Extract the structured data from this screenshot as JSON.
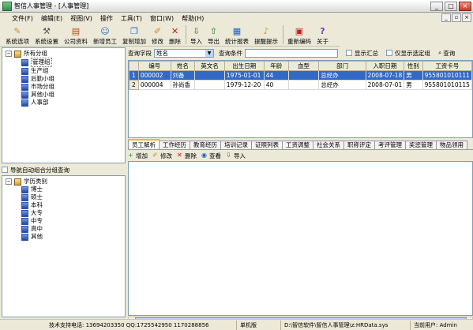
{
  "window": {
    "title": "智信人事管理 - [人事管理]"
  },
  "menu": [
    "文件(F)",
    "编辑(E)",
    "视图(V)",
    "操作",
    "工具(T)",
    "窗口(W)",
    "帮助(H)"
  ],
  "toolbar": [
    {
      "label": "系统选项",
      "icon": "pencil-icon"
    },
    {
      "label": "系统设置",
      "icon": "tools-icon"
    },
    {
      "label": "公司资料",
      "icon": "books-icon"
    },
    {
      "label": "新增员工",
      "icon": "person-add-icon"
    },
    {
      "label": "复制增加",
      "icon": "copy-icon"
    },
    {
      "label": "修改",
      "icon": "edit-icon"
    },
    {
      "label": "删除",
      "icon": "delete-icon"
    },
    {
      "label": "导入",
      "icon": "import-icon"
    },
    {
      "label": "导出",
      "icon": "export-icon"
    },
    {
      "label": "统计报表",
      "icon": "report-icon"
    },
    {
      "label": "提醒提示",
      "icon": "bell-icon"
    },
    {
      "label": "重新编码",
      "icon": "recode-icon"
    },
    {
      "label": "关于",
      "icon": "help-icon"
    }
  ],
  "tree1": {
    "root": "所有分组",
    "items": [
      "管理组",
      "生产组",
      "后勤小组",
      "市场分组",
      "其他小组",
      "人事部"
    ]
  },
  "split_label": "导航自动组合分组查询",
  "tree2": {
    "root": "学历类别",
    "items": [
      "博士",
      "硕士",
      "本科",
      "大专",
      "中专",
      "高中",
      "其他"
    ]
  },
  "query": {
    "field_label": "查询字段",
    "field_value": "姓名",
    "cond_label": "查询条件",
    "show_summary": "显示汇总",
    "show_selected_only": "仅显示选定组",
    "search_btn": "查询"
  },
  "grid": {
    "columns": [
      "编号",
      "姓名",
      "英文名",
      "出生日期",
      "年龄",
      "血型",
      "部门",
      "入职日期",
      "性别",
      "工资卡号"
    ],
    "rows": [
      [
        "000002",
        "刘备",
        "",
        "1975-01-01",
        "44",
        "",
        "总经办",
        "2008-07-18",
        "男",
        "955801010111"
      ],
      [
        "000004",
        "孙尚香",
        "",
        "1979-12-20",
        "40",
        "",
        "总经办",
        "2008-07-01",
        "男",
        "955801010115"
      ]
    ],
    "row_headers": [
      "1",
      "2"
    ]
  },
  "tabs": [
    "员工解析",
    "工作经历",
    "教育经历",
    "培训记录",
    "证照列表",
    "工资调整",
    "社会关系",
    "职称评定",
    "考评管理",
    "奖惩管理",
    "物品领用"
  ],
  "subtoolbar": [
    {
      "label": "增加",
      "icon": "add-icon"
    },
    {
      "label": "修改",
      "icon": "edit-icon"
    },
    {
      "label": "删除",
      "icon": "delete-icon"
    },
    {
      "label": "查看",
      "icon": "view-icon"
    },
    {
      "label": "导入",
      "icon": "import-icon"
    }
  ],
  "status": {
    "support": "技术支持电话: 13694203350 QQ:1725542950 1170288856",
    "mode": "单机版",
    "path": "D:\\智信软件\\智信人事管理\\z:HRData.sys",
    "user": "当前用户: Admin"
  }
}
